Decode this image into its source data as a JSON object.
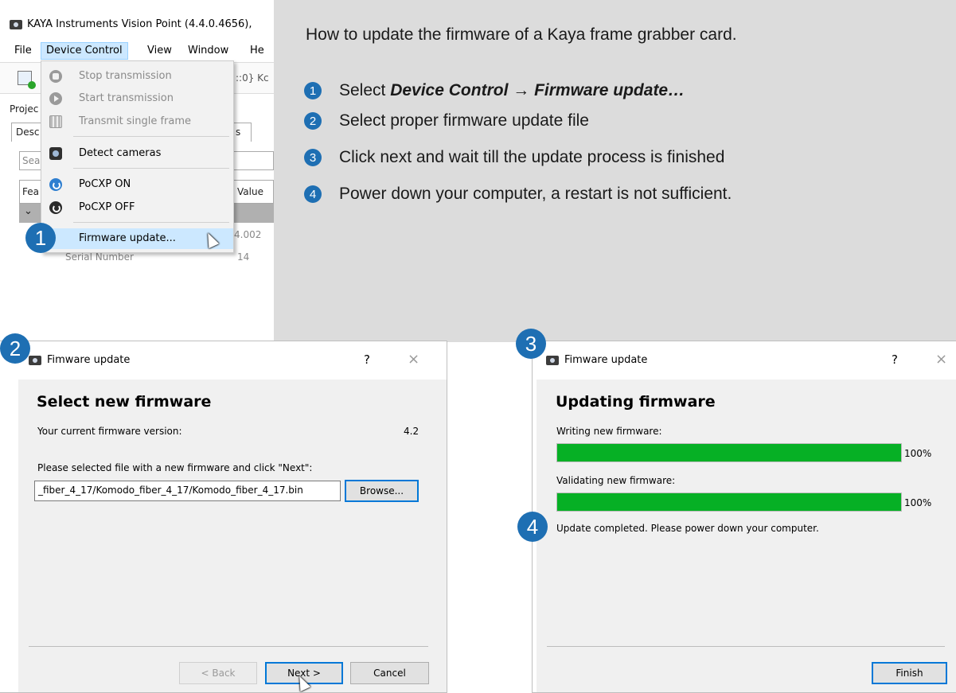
{
  "instructions": {
    "title": "How to update the firmware of a Kaya frame grabber card.",
    "steps": [
      {
        "num": "1",
        "prefix": "Select ",
        "bold": "Device Control → Firmware update…"
      },
      {
        "num": "2",
        "text": "Select proper firmware update file"
      },
      {
        "num": "3",
        "text": "Click next and wait till the update process is finished"
      },
      {
        "num": "4",
        "text": "Power down your computer, a restart is not sufficient."
      }
    ]
  },
  "main_window": {
    "title": "KAYA Instruments Vision Point (4.4.0.4656),",
    "menus": [
      "File",
      "Device Control",
      "View",
      "Window",
      "He"
    ],
    "toolbar_text": "::0} Kc",
    "bg_labels": {
      "projects": "Projec",
      "desc": "Desc",
      "tab_s": "s",
      "search": "Sear",
      "feature": "Fea",
      "value": "Value",
      "version_value": "4.002",
      "serial_label": "Serial Number",
      "serial_value": "14"
    },
    "dropdown": [
      {
        "icon": "stop-icon",
        "label": "Stop transmission",
        "disabled": true
      },
      {
        "icon": "play-icon",
        "label": "Start transmission",
        "disabled": true
      },
      {
        "icon": "film-icon",
        "label": "Transmit single frame",
        "disabled": true
      },
      {
        "icon": "camera-icon",
        "label": "Detect cameras",
        "disabled": false
      },
      {
        "icon": "power-on-icon",
        "label": "PoCXP ON",
        "disabled": false
      },
      {
        "icon": "power-off-icon",
        "label": "PoCXP OFF",
        "disabled": false
      },
      {
        "icon": "",
        "label": "Firmware update...",
        "disabled": false
      }
    ]
  },
  "badges": [
    "1",
    "2",
    "3",
    "4"
  ],
  "dialog_select": {
    "title": "Fimware update",
    "help": "?",
    "close": "×",
    "heading": "Select new firmware",
    "current_label": "Your current firmware version:",
    "current_value": "4.2",
    "instruction": "Please selected file with a new firmware and click \"Next\":",
    "path": "_fiber_4_17/Komodo_fiber_4_17/Komodo_fiber_4_17.bin",
    "browse": "Browse...",
    "back": "< Back",
    "next": "Next >",
    "cancel": "Cancel"
  },
  "dialog_update": {
    "title": "Fimware update",
    "help": "?",
    "close": "×",
    "heading": "Updating firmware",
    "writing_label": "Writing new firmware:",
    "writing_percent": "100%",
    "writing_progress": 1.0,
    "validating_label": "Validating new firmware:",
    "validating_percent": "100%",
    "validating_progress": 1.0,
    "completed": "Update completed. Please power down your computer.",
    "finish": "Finish"
  },
  "colors": {
    "accent": "#1e6fb3",
    "progress": "#06b025",
    "menu_highlight": "#cce8ff",
    "panel_bg": "#dcdcdc"
  }
}
